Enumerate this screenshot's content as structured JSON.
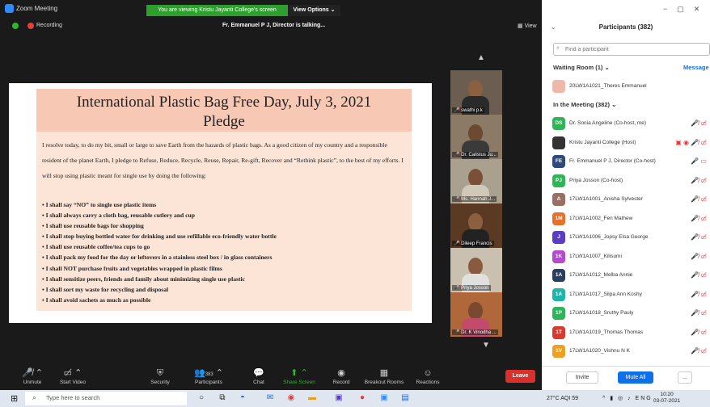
{
  "window": {
    "title": "Zoom Meeting",
    "banner": "You are viewing Kristu Jayanti College's screen",
    "view_options": "View Options ⌄"
  },
  "meeting": {
    "recording": "Recording",
    "talking": "Fr. Emmanuel P J, Director is talking...",
    "view_label": "View"
  },
  "slide": {
    "title": "International Plastic Bag Free Day, July 3, 2021",
    "subtitle": "Pledge",
    "paragraph": "I resolve today, to do my bit, small or large to save Earth from the hazards of plastic bags.  As a good citizen of my country and a responsible resident of the planet Earth, I pledge to Refuse, Reduce, Recycle, Reuse, Repair, Re-gift, Recover and “Rethink plastic”, to the best of my efforts. I will stop using plastic meant for single use by doing the following:",
    "items": [
      "I shall say “NO” to single use plastic items",
      "I shall always carry a cloth bag, reusable cutlery and cup",
      "I shall use reusable bags for shopping",
      "I shall stop buying bottled water for drinking and use refillable eco-friendly water bottle",
      "I shall use reusable coffee/tea cups to go",
      "I shall pack my food for the day or leftovers in a stainless steel box / in glass containers",
      "I shall NOT purchase fruits and vegetables wrapped in plastic films",
      "I shall sensitize peers, friends and family about minimizing single use plastic",
      "I shall sort my waste for recycling and disposal",
      "I shall avoid sachets as much as possible"
    ]
  },
  "video_tiles": [
    "swathi p.k",
    "Dr. Calistus Ju...",
    "Ms. Hannah J...",
    "Dileep Francis",
    "Priya Josson",
    "Dr. K Vinodha ..."
  ],
  "toolbar": {
    "unmute": "Unmute",
    "start_video": "Start Video",
    "security": "Security",
    "participants": "Participants",
    "participants_count": "383",
    "chat": "Chat",
    "share_screen": "Share Screen",
    "record": "Record",
    "breakout": "Breakout Rooms",
    "reactions": "Reactions",
    "leave": "Leave"
  },
  "panel": {
    "title": "Participants (382)",
    "search_placeholder": "Find a participant",
    "waiting_label": "Waiting Room (1) ⌄",
    "message_all": "Message",
    "waiting": [
      {
        "initials": "",
        "name": "20LW1A1021_Theres Emmanuel",
        "color": "#f0b8a8"
      }
    ],
    "in_meeting_label": "In the Meeting (382) ⌄",
    "participants": [
      {
        "initials": "DS",
        "name": "Dr. Sonia Angeline (Co-host, me)",
        "color": "#2fb457",
        "icons": "🎤̸ ▭̸"
      },
      {
        "initials": "",
        "name": "Kristu Jayanti College (Host)",
        "color": "#333333",
        "icons": "▣ ◉ 🎤̸ ▭̸"
      },
      {
        "initials": "FE",
        "name": "Fr. Emmanuel P J, Director (Co-host)",
        "color": "#2d4a7a",
        "icons": "🎤 ▭"
      },
      {
        "initials": "PJ",
        "name": "Priya Josson (Co-host)",
        "color": "#2fb457",
        "icons": "🎤̸ ▭̸"
      },
      {
        "initials": "A",
        "name": "17LW1A1001_Anisha Sylvester",
        "color": "#9a6e62",
        "icons": "🎤̸ ▭̸"
      },
      {
        "initials": "1M",
        "name": "17LW1A1002_Fen Mathew",
        "color": "#e8702a",
        "icons": "🎤̸ ▭̸"
      },
      {
        "initials": "J",
        "name": "17LW1A1006_Jopsy Elsa George",
        "color": "#5b3cc4",
        "icons": "🎤̸ ▭̸"
      },
      {
        "initials": "1K",
        "name": "17LW1A1007_Kilisumi",
        "color": "#b44bd0",
        "icons": "🎤̸ ▭̸"
      },
      {
        "initials": "1A",
        "name": "17LW1A1012_Melba Annie",
        "color": "#2a3f5f",
        "icons": "🎤̸ ▭̸"
      },
      {
        "initials": "1A",
        "name": "17LW1A1017_Silpa Ann Koshy",
        "color": "#1fb5a8",
        "icons": "🎤̸ ▭̸"
      },
      {
        "initials": "1P",
        "name": "17LW1A1018_Sruthy Pauly",
        "color": "#2fb457",
        "icons": "🎤̸ ▭̸"
      },
      {
        "initials": "1T",
        "name": "17LW1A1019_Thomas Thomas",
        "color": "#d93a2b",
        "icons": "🎤̸ ▭̸"
      },
      {
        "initials": "1V",
        "name": "17LW1A1020_Vishnu N K",
        "color": "#f0a020",
        "icons": "🎤̸ ▭̸"
      }
    ],
    "invite": "Invite",
    "mute_all": "Mute All",
    "more": "..."
  },
  "taskbar": {
    "search": "Type here to search",
    "weather": "27°C AQI 59",
    "lang": "ENG",
    "time": "10:20",
    "date": "03-07-2021"
  }
}
